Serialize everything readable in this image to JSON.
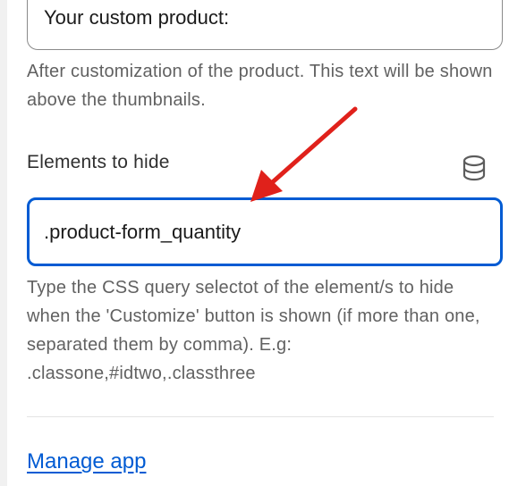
{
  "section_title": {
    "value": "Your custom product:",
    "help": "After customization of the product. This text will be shown above the thumbnails."
  },
  "elements_to_hide": {
    "label": "Elements to hide",
    "icon": "database-icon",
    "value": ".product-form_quantity",
    "help": "Type the CSS query selectot of the element/s to hide when the 'Customize' button is shown (if more than one, separated them by comma). E.g: .classone,#idtwo,.classthree"
  },
  "footer": {
    "manage_link": "Manage app"
  },
  "annotation": {
    "arrow_color": "#e0211b"
  },
  "colors": {
    "focus": "#005bd3",
    "link": "#005bd3",
    "help_text": "#616161"
  }
}
